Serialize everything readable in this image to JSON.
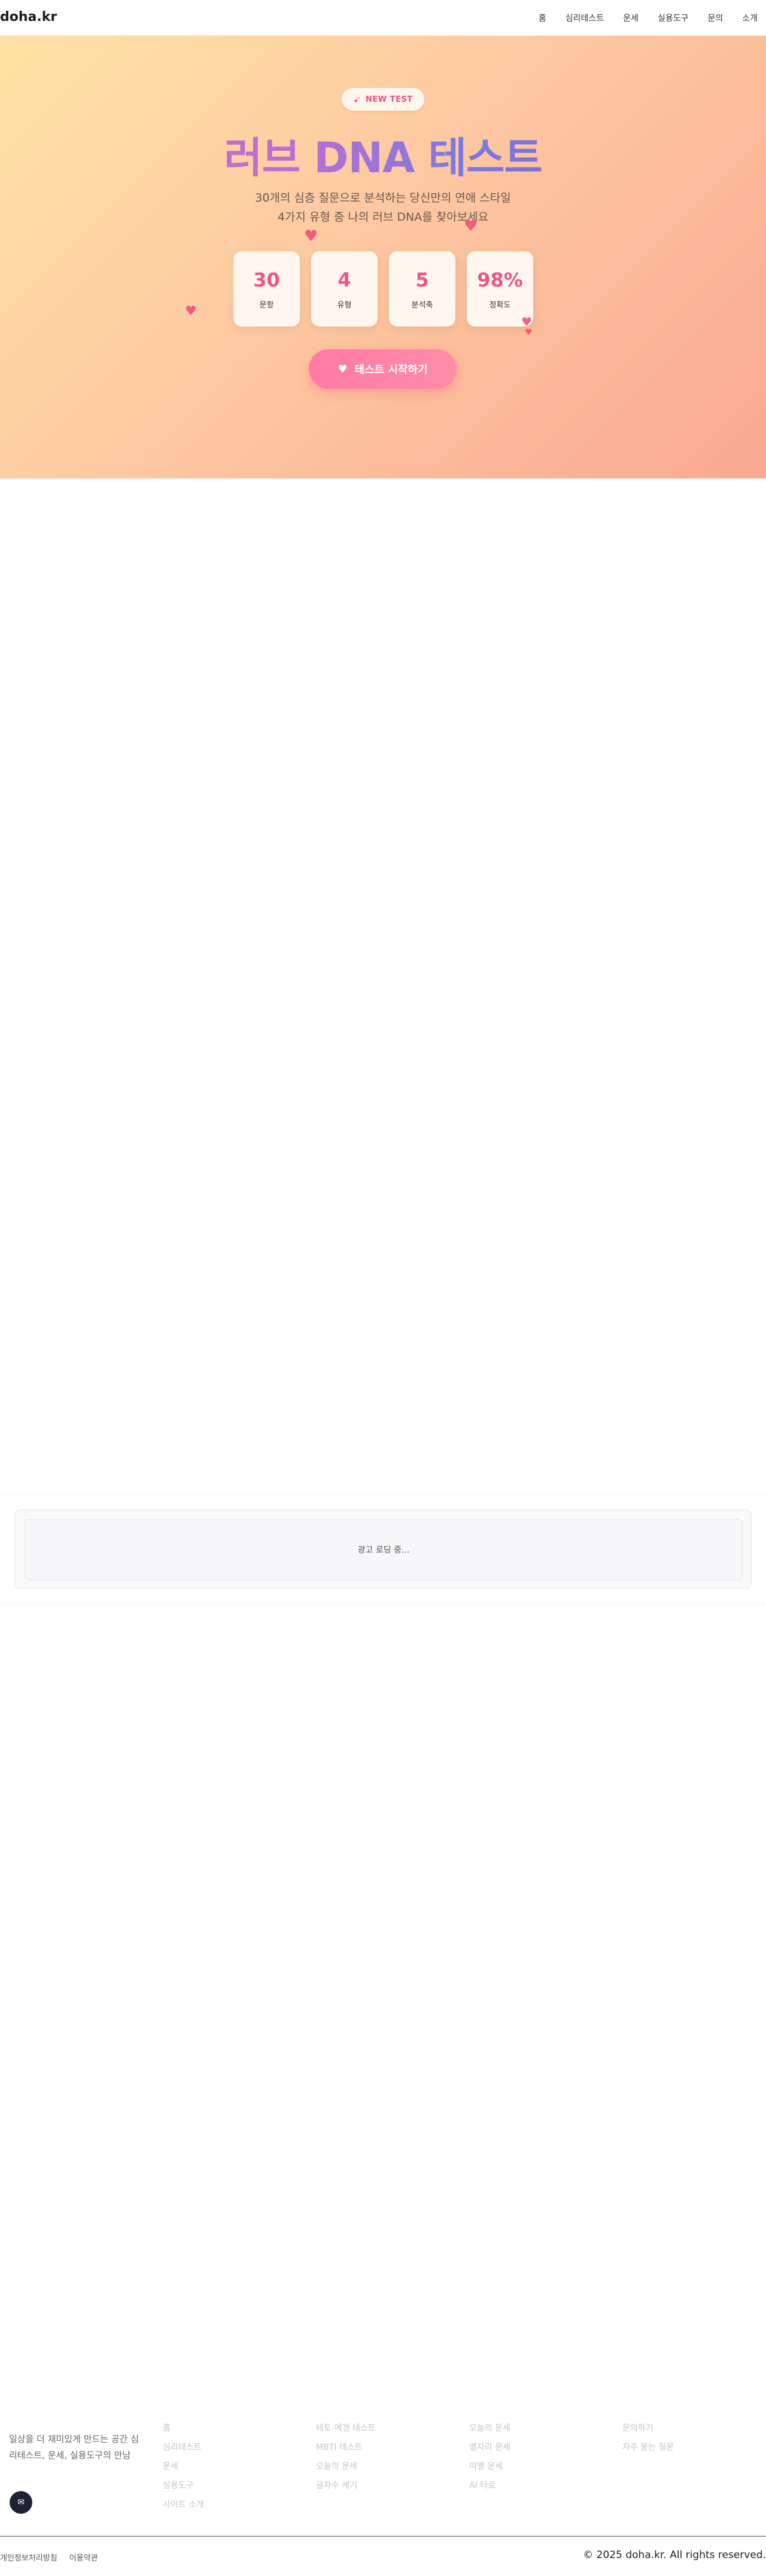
{
  "header": {
    "logo": "doha.kr",
    "nav": [
      "홈",
      "심리테스트",
      "운세",
      "실용도구",
      "문의",
      "소개"
    ]
  },
  "hero": {
    "badge": "NEW TEST",
    "title": "러브 DNA 테스트",
    "subtitle_line1": "30개의 심층 질문으로 분석하는 당신만의 연애 스타일",
    "subtitle_line2": "4가지 유형 중 나의 러브 DNA를 찾아보세요",
    "stats": [
      {
        "value": "30",
        "label": "문항"
      },
      {
        "value": "4",
        "label": "유형"
      },
      {
        "value": "5",
        "label": "분석축"
      },
      {
        "value": "98%",
        "label": "정확도"
      }
    ],
    "cta_label": "테스트 시작하기"
  },
  "ad": {
    "loading": "광고 로딩 중..."
  },
  "footer": {
    "description": "일상을 더 재미있게 만드는 공간 심리테스트, 운세, 실용도구의 만남",
    "columns": [
      [
        "홈",
        "심리테스트",
        "운세",
        "실용도구",
        "사이트 소개"
      ],
      [
        "테토-에겐 테스트",
        "MBTI 테스트",
        "오늘의 운세",
        "글자수 세기"
      ],
      [
        "오늘의 운세",
        "별자리 운세",
        "띠별 운세",
        "AI 타로"
      ],
      [
        "문의하기",
        "자주 묻는 질문"
      ]
    ],
    "links": [
      "개인정보처리방침",
      "이용약관"
    ],
    "copyright": "© 2025 doha.kr. All rights reserved."
  },
  "colors": {
    "accent": "#ec5687",
    "hero_gradient_start": "#ffe3a3",
    "hero_gradient_end": "#f9a98f",
    "title_gradient_start": "#e06db0",
    "title_gradient_end": "#6f5fc8"
  },
  "icons": {
    "badge": "rocket-icon",
    "cta": "heart-icon",
    "footer": "chat-icon"
  }
}
